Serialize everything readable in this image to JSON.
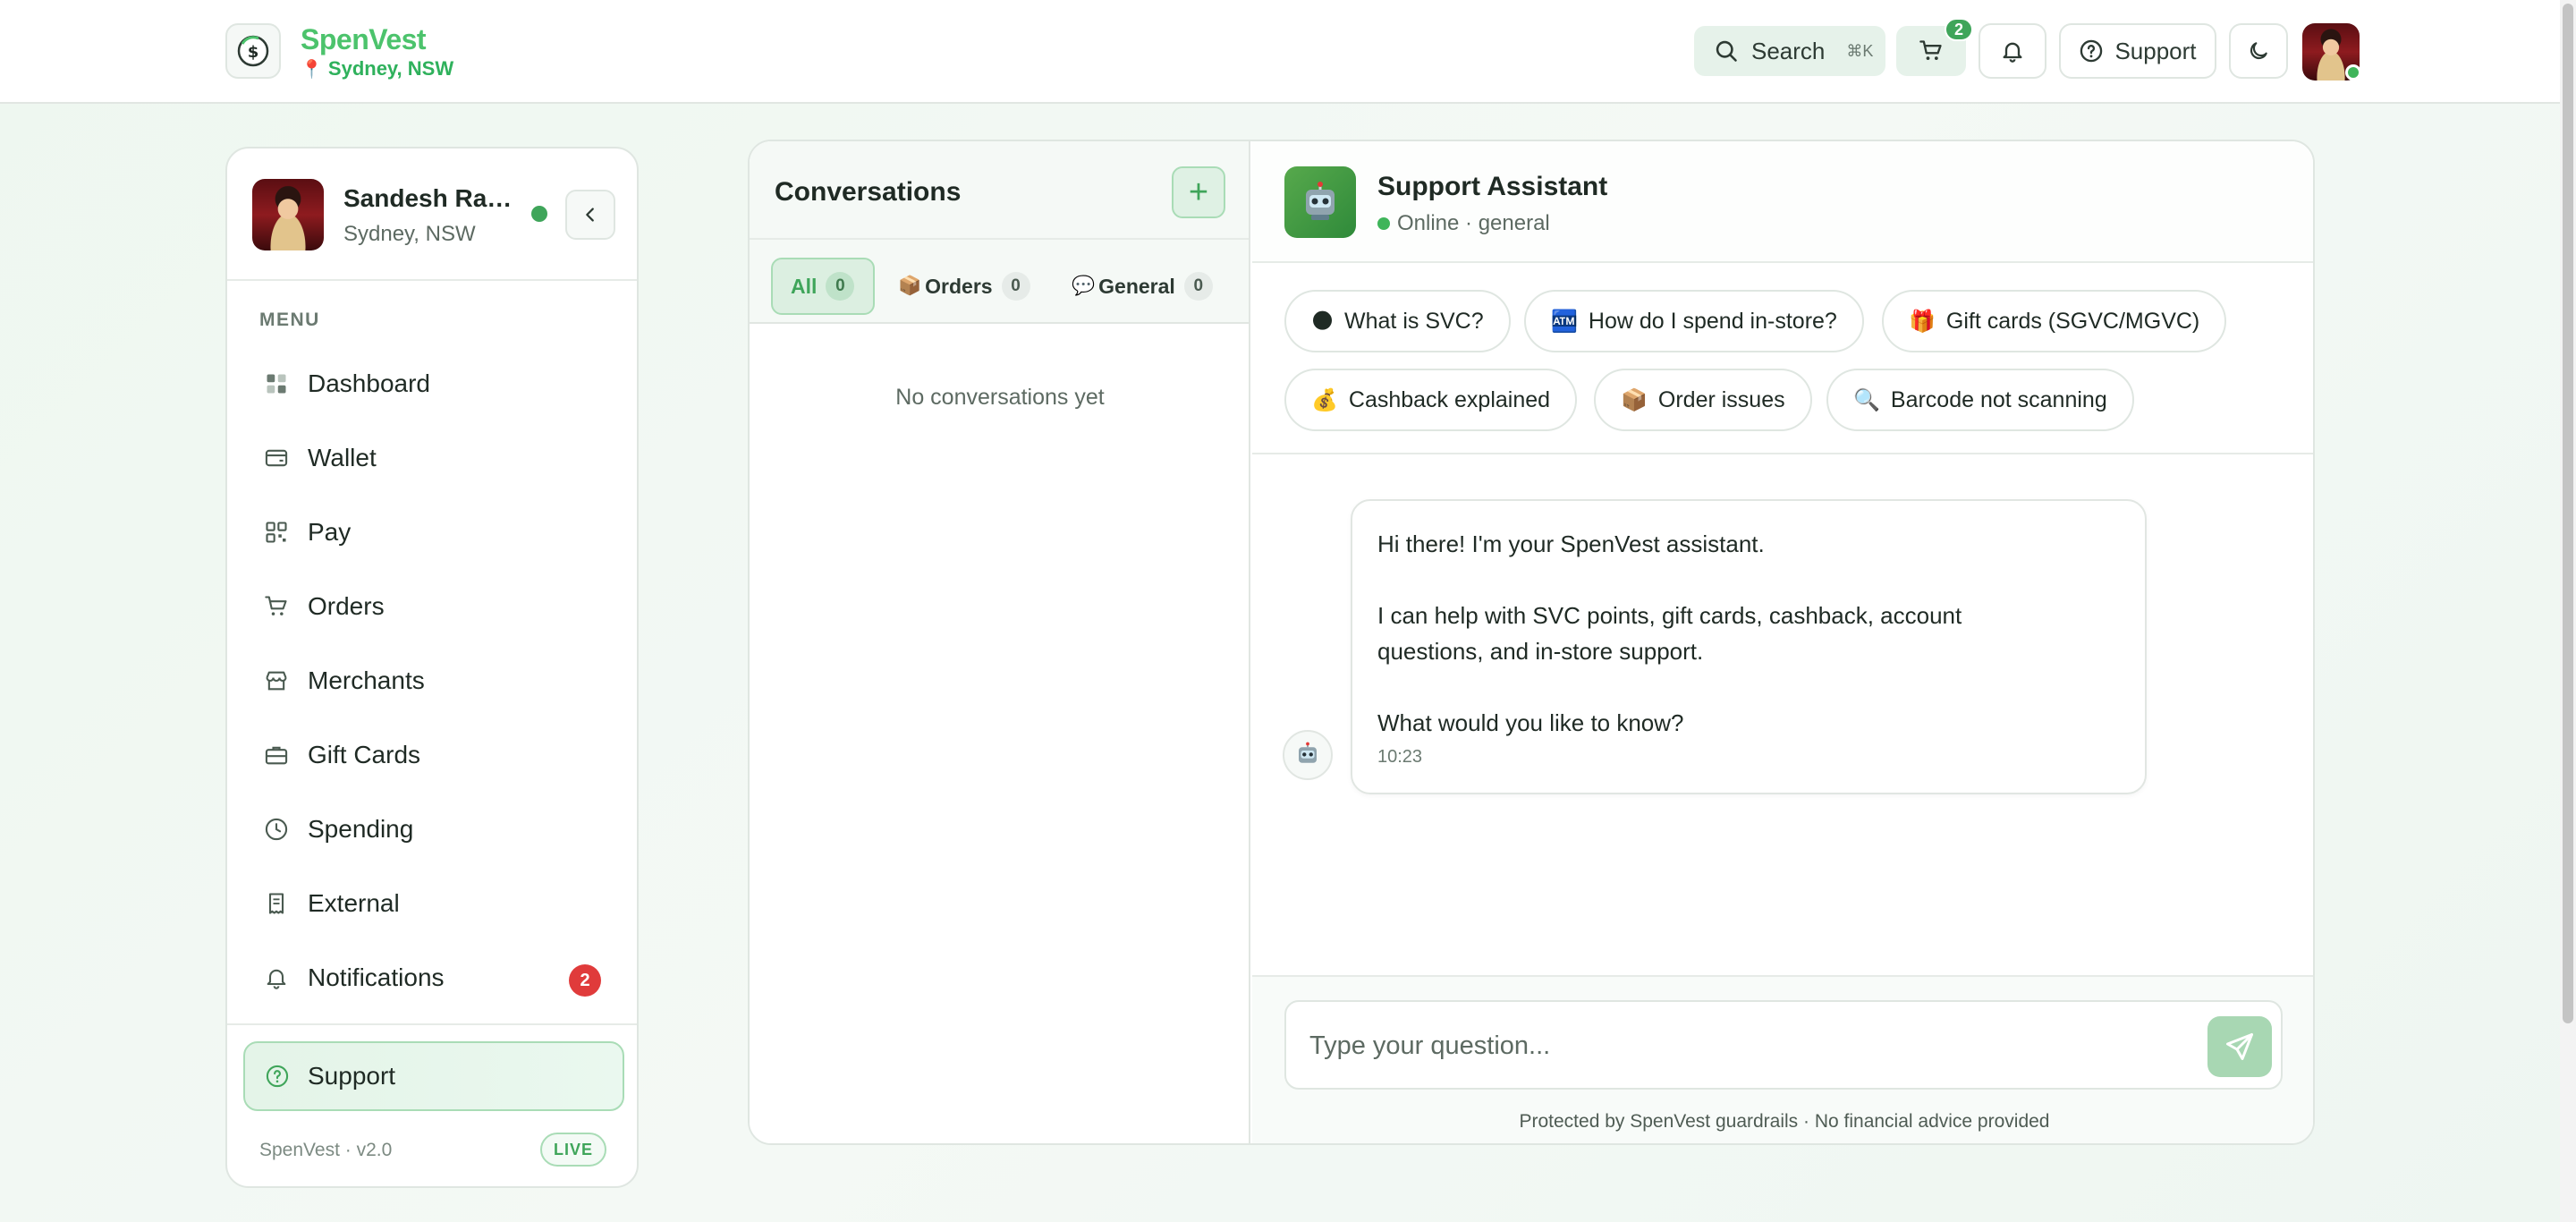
{
  "brand": {
    "name": "SpenVest",
    "location": "Sydney, NSW",
    "logo_icon": "dollar-circle-icon"
  },
  "header": {
    "search_label": "Search",
    "search_shortcut": "⌘K",
    "cart_count": "2",
    "support_label": "Support"
  },
  "profile": {
    "name": "Sandesh Ran...",
    "location": "Sydney, NSW",
    "online": true
  },
  "sidebar": {
    "menu_label": "MENU",
    "items": [
      {
        "label": "Dashboard",
        "icon": "grid-icon"
      },
      {
        "label": "Wallet",
        "icon": "wallet-icon"
      },
      {
        "label": "Pay",
        "icon": "qr-icon"
      },
      {
        "label": "Orders",
        "icon": "cart-icon"
      },
      {
        "label": "Merchants",
        "icon": "store-icon"
      },
      {
        "label": "Gift Cards",
        "icon": "briefcase-icon"
      },
      {
        "label": "Spending",
        "icon": "clock-icon"
      },
      {
        "label": "External",
        "icon": "receipt-icon"
      },
      {
        "label": "Notifications",
        "icon": "bell-icon",
        "badge": "2"
      }
    ],
    "support_label": "Support",
    "version": "SpenVest · v2.0",
    "live_label": "LIVE"
  },
  "conversations": {
    "title": "Conversations",
    "add_label": "+",
    "filters": [
      {
        "label": "All",
        "count": "0",
        "emoji": ""
      },
      {
        "label": "Orders",
        "count": "0",
        "emoji": "📦"
      },
      {
        "label": "General",
        "count": "0",
        "emoji": "💬"
      }
    ],
    "empty_message": "No conversations yet"
  },
  "chat": {
    "assistant_name": "Support Assistant",
    "status": "Online · general",
    "quick_replies": [
      {
        "emoji": "🌑",
        "label": "What is SVC?"
      },
      {
        "emoji": "🏧",
        "label": "How do I spend in-store?"
      },
      {
        "emoji": "🎁",
        "label": "Gift cards (SGVC/MGVC)"
      },
      {
        "emoji": "💰",
        "label": "Cashback explained"
      },
      {
        "emoji": "📦",
        "label": "Order issues"
      },
      {
        "emoji": "🔍",
        "label": "Barcode not scanning"
      }
    ],
    "message": {
      "line1": "Hi there! I'm your SpenVest assistant.",
      "line2": "I can help with SVC points, gift cards, cashback, account questions, and in-store support.",
      "line3": "What would you like to know?",
      "time": "10:23"
    },
    "input_placeholder": "Type your question...",
    "disclaimer": "Protected by SpenVest guardrails · No financial advice provided"
  },
  "colors": {
    "accent": "#3fa55a",
    "brand": "#4cc36c",
    "danger": "#e03b3b"
  }
}
